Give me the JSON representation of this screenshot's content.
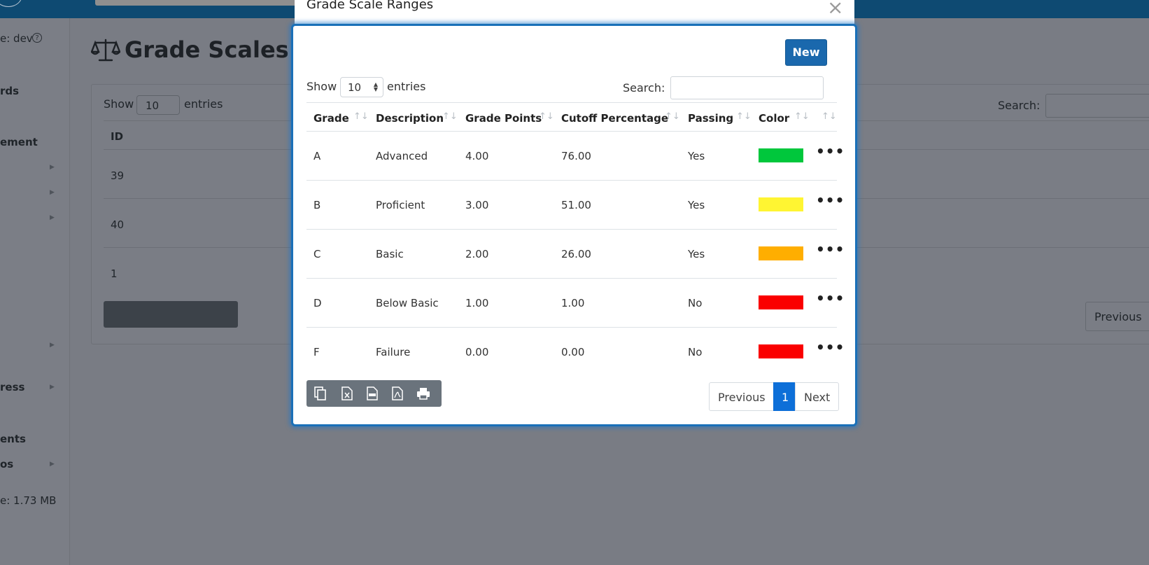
{
  "background": {
    "sidebar_items": [
      {
        "label": "e: dev",
        "bold": false
      },
      {
        "label": "rds",
        "bold": true
      },
      {
        "label": "ement",
        "bold": true
      },
      {
        "label": "ress",
        "bold": true
      },
      {
        "label": "ents",
        "bold": true
      },
      {
        "label": "os",
        "bold": true
      },
      {
        "label": "e: 1.73 MB",
        "bold": false
      }
    ],
    "page_title": "Grade Scales",
    "show_label": "Show",
    "entries_label": "entries",
    "page_size": "10",
    "search_label": "Search:",
    "id_header": "ID",
    "ids": [
      "39",
      "40",
      "1"
    ],
    "previous_label": "Previous"
  },
  "modal": {
    "title": "Grade Scale Ranges",
    "close_label": "×",
    "new_button": "New",
    "show_label": "Show",
    "entries_label": "entries",
    "page_size": "10",
    "search_label": "Search:",
    "search_value": "",
    "columns": [
      "Grade",
      "Description",
      "Grade Points",
      "Cutoff Percentage",
      "Passing",
      "Color"
    ],
    "rows": [
      {
        "grade": "A",
        "description": "Advanced",
        "points": "4.00",
        "cutoff": "76.00",
        "passing": "Yes",
        "color": "#00c73c"
      },
      {
        "grade": "B",
        "description": "Proficient",
        "points": "3.00",
        "cutoff": "51.00",
        "passing": "Yes",
        "color": "#fff532"
      },
      {
        "grade": "C",
        "description": "Basic",
        "points": "2.00",
        "cutoff": "26.00",
        "passing": "Yes",
        "color": "#ffae00"
      },
      {
        "grade": "D",
        "description": "Below Basic",
        "points": "1.00",
        "cutoff": "1.00",
        "passing": "No",
        "color": "#fa0000"
      },
      {
        "grade": "F",
        "description": "Failure",
        "points": "0.00",
        "cutoff": "0.00",
        "passing": "No",
        "color": "#fa0000"
      }
    ],
    "actions_label": "•••",
    "pagination": {
      "previous": "Previous",
      "current": "1",
      "next": "Next"
    },
    "toolbar_icons": [
      "copy-icon",
      "excel-icon",
      "csv-icon",
      "pdf-icon",
      "print-icon"
    ]
  },
  "colors": {
    "accent": "#1a68ad",
    "modal_border": "#1a70b8",
    "page_active": "#0d6fd8",
    "topbar": "#0e4a72"
  }
}
